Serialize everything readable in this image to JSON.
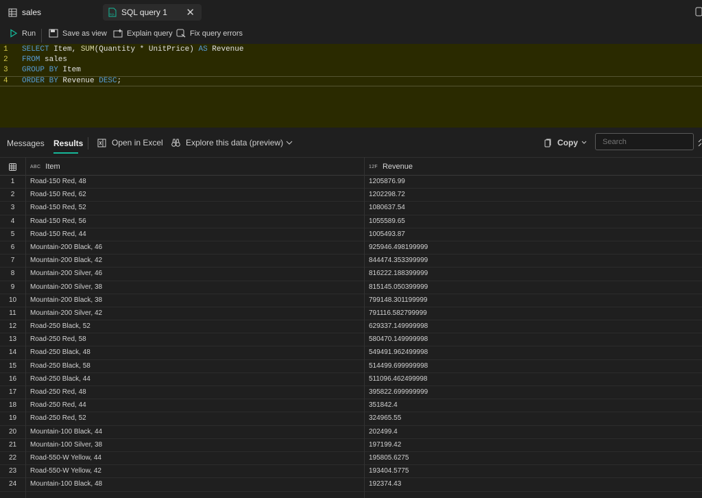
{
  "tabs": [
    {
      "label": "sales"
    },
    {
      "label": "SQL query 1"
    }
  ],
  "toolbar": {
    "run": "Run",
    "save_as_view": "Save as view",
    "explain_query": "Explain query",
    "fix_query_errors": "Fix query errors"
  },
  "editor": {
    "line_numbers": [
      "1",
      "2",
      "3",
      "4"
    ]
  },
  "results_header": {
    "messages_tab": "Messages",
    "results_tab": "Results",
    "open_in_excel": "Open in Excel",
    "explore_data": "Explore this data (preview)",
    "copy": "Copy",
    "search_placeholder": "Search"
  },
  "grid": {
    "columns": [
      {
        "type": "ABC",
        "name": "Item"
      },
      {
        "type": "12F",
        "name": "Revenue"
      }
    ],
    "rows": [
      {
        "n": "1",
        "item": "Road-150 Red, 48",
        "revenue": "1205876.99"
      },
      {
        "n": "2",
        "item": "Road-150 Red, 62",
        "revenue": "1202298.72"
      },
      {
        "n": "3",
        "item": "Road-150 Red, 52",
        "revenue": "1080637.54"
      },
      {
        "n": "4",
        "item": "Road-150 Red, 56",
        "revenue": "1055589.65"
      },
      {
        "n": "5",
        "item": "Road-150 Red, 44",
        "revenue": "1005493.87"
      },
      {
        "n": "6",
        "item": "Mountain-200 Black, 46",
        "revenue": "925946.498199999"
      },
      {
        "n": "7",
        "item": "Mountain-200 Black, 42",
        "revenue": "844474.353399999"
      },
      {
        "n": "8",
        "item": "Mountain-200 Silver, 46",
        "revenue": "816222.188399999"
      },
      {
        "n": "9",
        "item": "Mountain-200 Silver, 38",
        "revenue": "815145.050399999"
      },
      {
        "n": "10",
        "item": "Mountain-200 Black, 38",
        "revenue": "799148.301199999"
      },
      {
        "n": "11",
        "item": "Mountain-200 Silver, 42",
        "revenue": "791116.582799999"
      },
      {
        "n": "12",
        "item": "Road-250 Black, 52",
        "revenue": "629337.149999998"
      },
      {
        "n": "13",
        "item": "Road-250 Red, 58",
        "revenue": "580470.149999998"
      },
      {
        "n": "14",
        "item": "Road-250 Black, 48",
        "revenue": "549491.962499998"
      },
      {
        "n": "15",
        "item": "Road-250 Black, 58",
        "revenue": "514499.699999998"
      },
      {
        "n": "16",
        "item": "Road-250 Black, 44",
        "revenue": "511096.462499998"
      },
      {
        "n": "17",
        "item": "Road-250 Red, 48",
        "revenue": "395822.699999999"
      },
      {
        "n": "18",
        "item": "Road-250 Red, 44",
        "revenue": "351842.4"
      },
      {
        "n": "19",
        "item": "Road-250 Red, 52",
        "revenue": "324965.55"
      },
      {
        "n": "20",
        "item": "Mountain-100 Black, 44",
        "revenue": "202499.4"
      },
      {
        "n": "21",
        "item": "Mountain-100 Silver, 38",
        "revenue": "197199.42"
      },
      {
        "n": "22",
        "item": "Road-550-W Yellow, 44",
        "revenue": "195805.6275"
      },
      {
        "n": "23",
        "item": "Road-550-W Yellow, 42",
        "revenue": "193404.5775"
      },
      {
        "n": "24",
        "item": "Mountain-100 Black, 48",
        "revenue": "192374.43"
      }
    ]
  },
  "colors": {
    "accent": "#16b89a",
    "editor_bg": "#2a2a00",
    "keyword": "#569cd6",
    "function": "#dcdcaa"
  }
}
